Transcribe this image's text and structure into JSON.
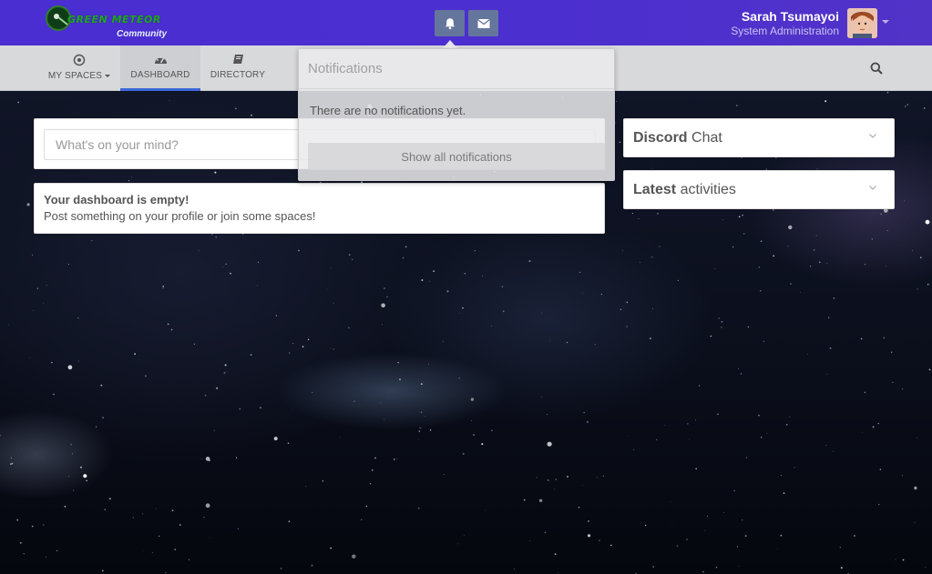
{
  "header": {
    "logo_text": "GREEN METEOR",
    "logo_subtitle": "Community",
    "notifications_icon": "bell-icon",
    "messages_icon": "envelope-icon",
    "user": {
      "name": "Sarah Tsumayoi",
      "role": "System Administration"
    }
  },
  "nav": {
    "items": [
      {
        "label": "MY SPACES",
        "icon": "target-icon",
        "has_caret": true,
        "active": false
      },
      {
        "label": "DASHBOARD",
        "icon": "dashboard-icon",
        "active": true
      },
      {
        "label": "DIRECTORY",
        "icon": "book-icon",
        "active": false
      }
    ],
    "search_icon": "search-icon"
  },
  "notifications": {
    "title": "Notifications",
    "empty_text": "There are no notifications yet.",
    "show_all_label": "Show all notifications"
  },
  "stream": {
    "post_placeholder": "What's on your mind?",
    "empty_title": "Your dashboard is empty!",
    "empty_text": "Post something on your profile or join some spaces!"
  },
  "sidebar": {
    "panels": [
      {
        "title_bold": "Discord",
        "title_rest": " Chat"
      },
      {
        "title_bold": "Latest",
        "title_rest": " activities"
      }
    ]
  },
  "colors": {
    "topbar": "#4a2ed1",
    "accent": "#3b68d8",
    "icon_button": "#65769c"
  }
}
